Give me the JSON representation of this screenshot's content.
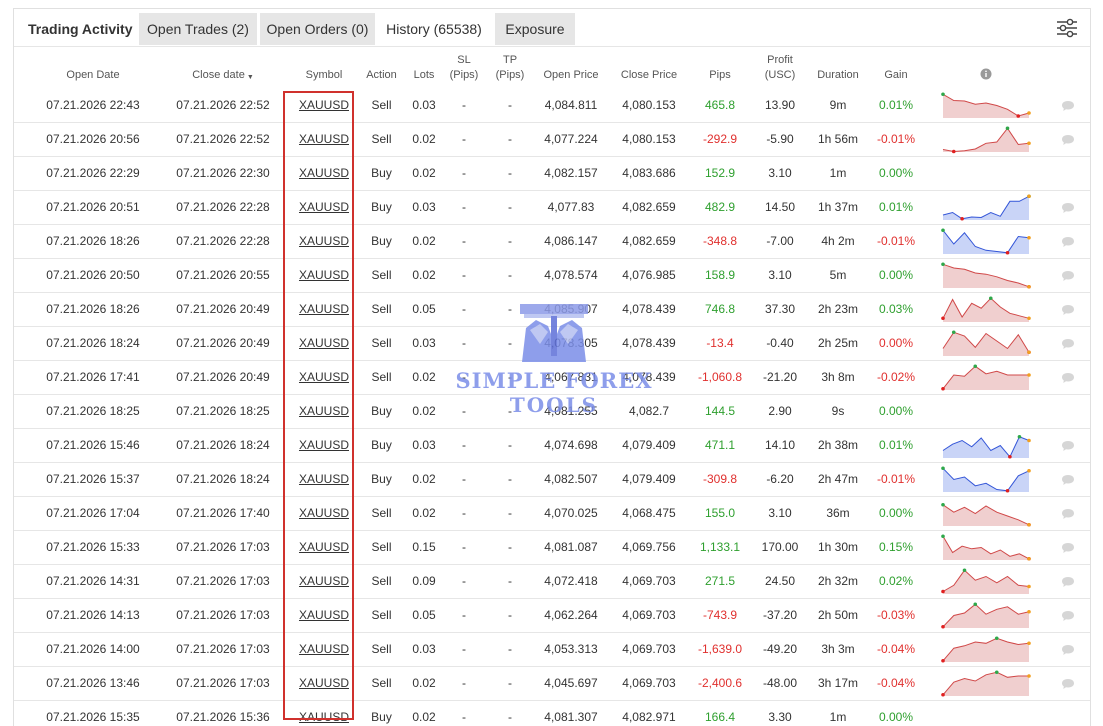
{
  "tabs": {
    "title": "Trading Activity",
    "open_trades": "Open Trades (2)",
    "open_orders": "Open Orders (0)",
    "history": "History (65538)",
    "exposure": "Exposure"
  },
  "columns": {
    "open_date": "Open Date",
    "close_date": "Close date",
    "symbol": "Symbol",
    "action": "Action",
    "lots": "Lots",
    "sl": [
      "SL",
      "(Pips)"
    ],
    "tp": [
      "TP",
      "(Pips)"
    ],
    "open_price": "Open Price",
    "close_price": "Close Price",
    "pips": "Pips",
    "profit": [
      "Profit",
      "(USC)"
    ],
    "duration": "Duration",
    "gain": "Gain"
  },
  "watermark": {
    "line1": "SIMPLE FOREX",
    "line2": "TOOLS"
  },
  "colors": {
    "positive": "#2e9f2e",
    "negative": "#e0302e",
    "highlight": "#d0312d"
  },
  "rows": [
    {
      "open": "07.21.2026 22:43",
      "close": "07.21.2026 22:52",
      "symbol": "XAUUSD",
      "action": "Sell",
      "lots": "0.03",
      "sl": "-",
      "tp": "-",
      "open_price": "4,084.811",
      "close_price": "4,080.153",
      "pips": "465.8",
      "profit": "13.90",
      "duration": "9m",
      "gain": "0.01%",
      "sign": "pos",
      "spark": {
        "color": "red",
        "pts": [
          0.95,
          0.7,
          0.68,
          0.55,
          0.6,
          0.5,
          0.35,
          0.08,
          0.2
        ]
      }
    },
    {
      "open": "07.21.2026 20:56",
      "close": "07.21.2026 22:52",
      "symbol": "XAUUSD",
      "action": "Sell",
      "lots": "0.02",
      "sl": "-",
      "tp": "-",
      "open_price": "4,077.224",
      "close_price": "4,080.153",
      "pips": "-292.9",
      "profit": "-5.90",
      "duration": "1h 56m",
      "gain": "-0.01%",
      "sign": "neg",
      "spark": {
        "color": "red",
        "pts": [
          0.1,
          0.02,
          0.05,
          0.12,
          0.35,
          0.4,
          0.95,
          0.3,
          0.35
        ]
      }
    },
    {
      "open": "07.21.2026 22:29",
      "close": "07.21.2026 22:30",
      "symbol": "XAUUSD",
      "action": "Buy",
      "lots": "0.02",
      "sl": "-",
      "tp": "-",
      "open_price": "4,082.157",
      "close_price": "4,083.686",
      "pips": "152.9",
      "profit": "3.10",
      "duration": "1m",
      "gain": "0.00%",
      "sign": "pos",
      "spark": null
    },
    {
      "open": "07.21.2026 20:51",
      "close": "07.21.2026 22:28",
      "symbol": "XAUUSD",
      "action": "Buy",
      "lots": "0.03",
      "sl": "-",
      "tp": "-",
      "open_price": "4,077.83",
      "close_price": "4,082.659",
      "pips": "482.9",
      "profit": "14.50",
      "duration": "1h 37m",
      "gain": "0.01%",
      "sign": "pos",
      "spark": {
        "color": "blue",
        "pts": [
          0.2,
          0.3,
          0.05,
          0.12,
          0.1,
          0.3,
          0.15,
          0.75,
          0.75,
          0.95
        ]
      }
    },
    {
      "open": "07.21.2026 18:26",
      "close": "07.21.2026 22:28",
      "symbol": "XAUUSD",
      "action": "Buy",
      "lots": "0.02",
      "sl": "-",
      "tp": "-",
      "open_price": "4,086.147",
      "close_price": "4,082.659",
      "pips": "-348.8",
      "profit": "-7.00",
      "duration": "4h 2m",
      "gain": "-0.01%",
      "sign": "neg",
      "spark": {
        "color": "blue",
        "pts": [
          0.95,
          0.4,
          0.85,
          0.3,
          0.15,
          0.1,
          0.05,
          0.7,
          0.65
        ]
      }
    },
    {
      "open": "07.21.2026 20:50",
      "close": "07.21.2026 20:55",
      "symbol": "XAUUSD",
      "action": "Sell",
      "lots": "0.02",
      "sl": "-",
      "tp": "-",
      "open_price": "4,078.574",
      "close_price": "4,076.985",
      "pips": "158.9",
      "profit": "3.10",
      "duration": "5m",
      "gain": "0.00%",
      "sign": "pos",
      "spark": {
        "color": "red",
        "pts": [
          0.95,
          0.8,
          0.75,
          0.6,
          0.55,
          0.45,
          0.3,
          0.2,
          0.05
        ]
      }
    },
    {
      "open": "07.21.2026 18:26",
      "close": "07.21.2026 20:49",
      "symbol": "XAUUSD",
      "action": "Sell",
      "lots": "0.05",
      "sl": "-",
      "tp": "-",
      "open_price": "4,085.907",
      "close_price": "4,078.439",
      "pips": "746.8",
      "profit": "37.30",
      "duration": "2h 23m",
      "gain": "0.03%",
      "sign": "pos",
      "spark": {
        "color": "red",
        "pts": [
          0.15,
          0.9,
          0.2,
          0.75,
          0.55,
          0.95,
          0.6,
          0.35,
          0.25,
          0.15
        ]
      }
    },
    {
      "open": "07.21.2026 18:24",
      "close": "07.21.2026 20:49",
      "symbol": "XAUUSD",
      "action": "Sell",
      "lots": "0.03",
      "sl": "-",
      "tp": "-",
      "open_price": "4,078.305",
      "close_price": "4,078.439",
      "pips": "-13.4",
      "profit": "-0.40",
      "duration": "2h 25m",
      "gain": "0.00%",
      "sign": "neg",
      "spark": {
        "color": "red",
        "pts": [
          0.3,
          0.95,
          0.8,
          0.35,
          0.9,
          0.6,
          0.3,
          0.85,
          0.15
        ]
      }
    },
    {
      "open": "07.21.2026 17:41",
      "close": "07.21.2026 20:49",
      "symbol": "XAUUSD",
      "action": "Sell",
      "lots": "0.02",
      "sl": "-",
      "tp": "-",
      "open_price": "4,067.831",
      "close_price": "4,078.439",
      "pips": "-1,060.8",
      "profit": "-21.20",
      "duration": "3h 8m",
      "gain": "-0.02%",
      "sign": "neg",
      "spark": {
        "color": "red",
        "pts": [
          0.05,
          0.6,
          0.55,
          0.95,
          0.65,
          0.75,
          0.6,
          0.6,
          0.6
        ]
      }
    },
    {
      "open": "07.21.2026 18:25",
      "close": "07.21.2026 18:25",
      "symbol": "XAUUSD",
      "action": "Buy",
      "lots": "0.02",
      "sl": "-",
      "tp": "-",
      "open_price": "4,081.255",
      "close_price": "4,082.7",
      "pips": "144.5",
      "profit": "2.90",
      "duration": "9s",
      "gain": "0.00%",
      "sign": "pos",
      "spark": null
    },
    {
      "open": "07.21.2026 15:46",
      "close": "07.21.2026 18:24",
      "symbol": "XAUUSD",
      "action": "Buy",
      "lots": "0.03",
      "sl": "-",
      "tp": "-",
      "open_price": "4,074.698",
      "close_price": "4,079.409",
      "pips": "471.1",
      "profit": "14.10",
      "duration": "2h 38m",
      "gain": "0.01%",
      "sign": "pos",
      "spark": {
        "color": "blue",
        "pts": [
          0.3,
          0.55,
          0.7,
          0.45,
          0.8,
          0.3,
          0.5,
          0.05,
          0.85,
          0.7
        ]
      }
    },
    {
      "open": "07.21.2026 15:37",
      "close": "07.21.2026 18:24",
      "symbol": "XAUUSD",
      "action": "Buy",
      "lots": "0.02",
      "sl": "-",
      "tp": "-",
      "open_price": "4,082.507",
      "close_price": "4,079.409",
      "pips": "-309.8",
      "profit": "-6.20",
      "duration": "2h 47m",
      "gain": "-0.01%",
      "sign": "neg",
      "spark": {
        "color": "blue",
        "pts": [
          0.95,
          0.5,
          0.6,
          0.25,
          0.35,
          0.1,
          0.05,
          0.65,
          0.85
        ]
      }
    },
    {
      "open": "07.21.2026 17:04",
      "close": "07.21.2026 17:40",
      "symbol": "XAUUSD",
      "action": "Sell",
      "lots": "0.02",
      "sl": "-",
      "tp": "-",
      "open_price": "4,070.025",
      "close_price": "4,068.475",
      "pips": "155.0",
      "profit": "3.10",
      "duration": "36m",
      "gain": "0.00%",
      "sign": "pos",
      "spark": {
        "color": "red",
        "pts": [
          0.85,
          0.55,
          0.75,
          0.5,
          0.8,
          0.55,
          0.4,
          0.25,
          0.05
        ]
      }
    },
    {
      "open": "07.21.2026 15:33",
      "close": "07.21.2026 17:03",
      "symbol": "XAUUSD",
      "action": "Sell",
      "lots": "0.15",
      "sl": "-",
      "tp": "-",
      "open_price": "4,081.087",
      "close_price": "4,069.756",
      "pips": "1,133.1",
      "profit": "170.00",
      "duration": "1h 30m",
      "gain": "0.15%",
      "sign": "pos",
      "spark": {
        "color": "red",
        "pts": [
          0.95,
          0.3,
          0.55,
          0.45,
          0.5,
          0.25,
          0.4,
          0.15,
          0.25,
          0.05
        ]
      }
    },
    {
      "open": "07.21.2026 14:31",
      "close": "07.21.2026 17:03",
      "symbol": "XAUUSD",
      "action": "Sell",
      "lots": "0.09",
      "sl": "-",
      "tp": "-",
      "open_price": "4,072.418",
      "close_price": "4,069.703",
      "pips": "271.5",
      "profit": "24.50",
      "duration": "2h 32m",
      "gain": "0.02%",
      "sign": "pos",
      "spark": {
        "color": "red",
        "pts": [
          0.1,
          0.35,
          0.95,
          0.55,
          0.7,
          0.45,
          0.7,
          0.35,
          0.3
        ]
      }
    },
    {
      "open": "07.21.2026 14:13",
      "close": "07.21.2026 17:03",
      "symbol": "XAUUSD",
      "action": "Sell",
      "lots": "0.05",
      "sl": "-",
      "tp": "-",
      "open_price": "4,062.264",
      "close_price": "4,069.703",
      "pips": "-743.9",
      "profit": "-37.20",
      "duration": "2h 50m",
      "gain": "-0.03%",
      "sign": "neg",
      "spark": {
        "color": "red",
        "pts": [
          0.05,
          0.5,
          0.6,
          0.95,
          0.55,
          0.75,
          0.85,
          0.55,
          0.65
        ]
      }
    },
    {
      "open": "07.21.2026 14:00",
      "close": "07.21.2026 17:03",
      "symbol": "XAUUSD",
      "action": "Sell",
      "lots": "0.03",
      "sl": "-",
      "tp": "-",
      "open_price": "4,053.313",
      "close_price": "4,069.703",
      "pips": "-1,639.0",
      "profit": "-49.20",
      "duration": "3h 3m",
      "gain": "-0.04%",
      "sign": "neg",
      "spark": {
        "color": "red",
        "pts": [
          0.05,
          0.55,
          0.65,
          0.8,
          0.75,
          0.95,
          0.8,
          0.7,
          0.75
        ]
      }
    },
    {
      "open": "07.21.2026 13:46",
      "close": "07.21.2026 17:03",
      "symbol": "XAUUSD",
      "action": "Sell",
      "lots": "0.02",
      "sl": "-",
      "tp": "-",
      "open_price": "4,045.697",
      "close_price": "4,069.703",
      "pips": "-2,400.6",
      "profit": "-48.00",
      "duration": "3h 17m",
      "gain": "-0.04%",
      "sign": "neg",
      "spark": {
        "color": "red",
        "pts": [
          0.05,
          0.55,
          0.7,
          0.6,
          0.85,
          0.95,
          0.75,
          0.8,
          0.8
        ]
      }
    },
    {
      "open": "07.21.2026 15:35",
      "close": "07.21.2026 15:36",
      "symbol": "XAUUSD",
      "action": "Buy",
      "lots": "0.02",
      "sl": "-",
      "tp": "-",
      "open_price": "4,081.307",
      "close_price": "4,082.971",
      "pips": "166.4",
      "profit": "3.30",
      "duration": "1m",
      "gain": "0.00%",
      "sign": "pos",
      "spark": null
    }
  ]
}
